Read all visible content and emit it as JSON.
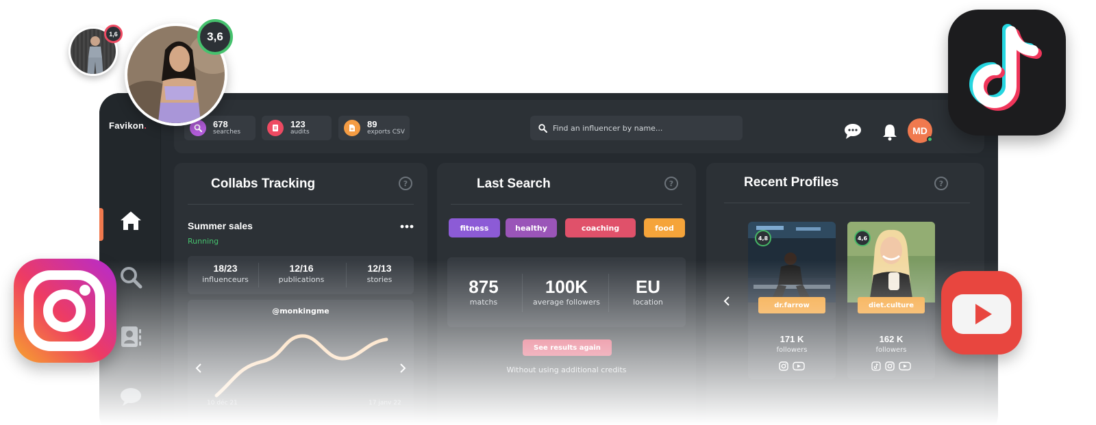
{
  "brand": {
    "name": "Favikon",
    "dot": "."
  },
  "stats": [
    {
      "value": "678",
      "label": "searches",
      "color": "#b35ddb",
      "icon": "search-icon"
    },
    {
      "value": "123",
      "label": "audits",
      "color": "#ee4a62",
      "icon": "audit-icon"
    },
    {
      "value": "89",
      "label": "exports CSV",
      "color": "#f59c43",
      "icon": "file-icon"
    }
  ],
  "search": {
    "placeholder": "Find an influencer by name..."
  },
  "user": {
    "initials": "MD"
  },
  "collabs": {
    "title": "Collabs Tracking",
    "help": "?",
    "campaign": "Summer sales",
    "status": "Running",
    "metrics": [
      {
        "value": "18/23",
        "label": "influenceurs"
      },
      {
        "value": "12/16",
        "label": "publications"
      },
      {
        "value": "12/13",
        "label": "stories"
      }
    ],
    "chart": {
      "handle": "@monkingme",
      "start": "10 déc 21",
      "end": "17 janv 22"
    }
  },
  "last_search": {
    "title": "Last Search",
    "help": "?",
    "tags": [
      {
        "label": "fitness",
        "color": "#8c5bd6"
      },
      {
        "label": "healthy",
        "color": "#9a55b8"
      },
      {
        "label": "coaching",
        "color": "#e0516a"
      },
      {
        "label": "food",
        "color": "#f5a43a"
      }
    ],
    "metrics": [
      {
        "value": "875",
        "label": "matchs"
      },
      {
        "value": "100K",
        "label": "average followers"
      },
      {
        "value": "EU",
        "label": "location"
      }
    ],
    "button": "See results again",
    "note": "Without using additional credits"
  },
  "recent": {
    "title": "Recent Profiles",
    "help": "?",
    "profiles": [
      {
        "score": "4,8",
        "name": "dr.farrow",
        "followers": "171 K",
        "label": "followers",
        "networks": [
          "instagram-icon",
          "youtube-icon"
        ]
      },
      {
        "score": "4,6",
        "name": "diet.culture",
        "followers": "162 K",
        "label": "followers",
        "networks": [
          "tiktok-icon",
          "instagram-icon",
          "youtube-icon"
        ]
      }
    ]
  },
  "floating": {
    "small_score": "1,6",
    "large_score": "3,6"
  }
}
